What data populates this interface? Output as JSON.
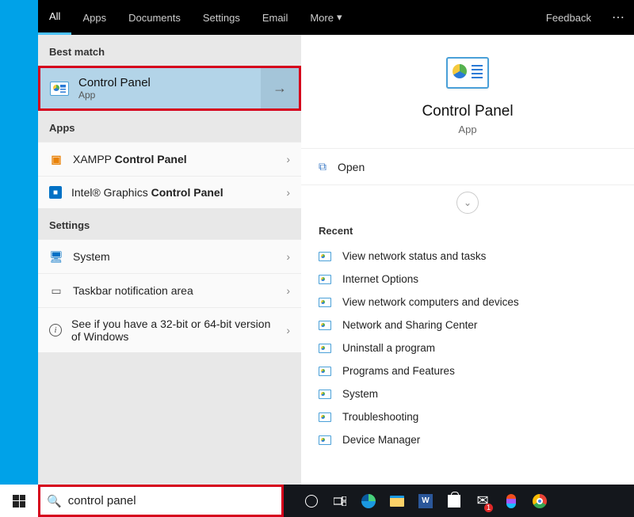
{
  "tabs": {
    "all": "All",
    "apps": "Apps",
    "documents": "Documents",
    "settings": "Settings",
    "email": "Email",
    "more": "More",
    "feedback": "Feedback"
  },
  "sections": {
    "best_match": "Best match",
    "apps": "Apps",
    "settings": "Settings",
    "recent": "Recent"
  },
  "best": {
    "title": "Control Panel",
    "subtitle": "App"
  },
  "apps_list": [
    {
      "prefix": "XAMPP ",
      "bold": "Control Panel",
      "icon": "xampp"
    },
    {
      "prefix": "Intel® Graphics ",
      "bold": "Control Panel",
      "icon": "intel"
    }
  ],
  "settings_list": [
    {
      "label": "System",
      "icon": "sys"
    },
    {
      "label": "Taskbar notification area",
      "icon": "task"
    },
    {
      "label": "See if you have a 32-bit or 64-bit version of Windows",
      "icon": "info"
    }
  ],
  "hero": {
    "title": "Control Panel",
    "subtitle": "App"
  },
  "open_label": "Open",
  "recent_items": [
    "View network status and tasks",
    "Internet Options",
    "View network computers and devices",
    "Network and Sharing Center",
    "Uninstall a program",
    "Programs and Features",
    "System",
    "Troubleshooting",
    "Device Manager"
  ],
  "search": {
    "value": "control panel"
  }
}
